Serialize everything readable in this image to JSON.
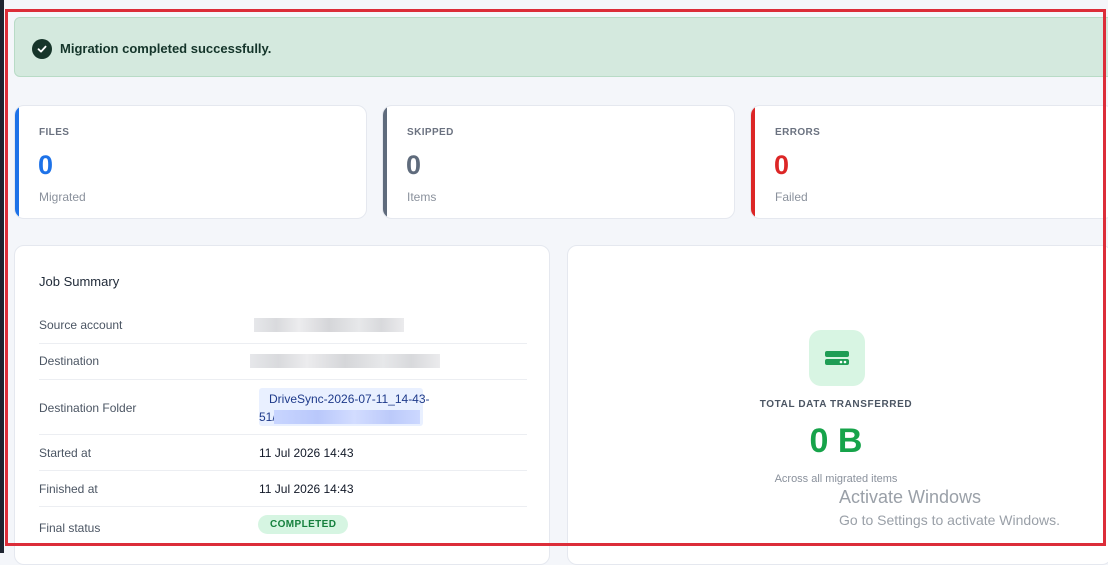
{
  "banner": {
    "message": "Migration completed successfully."
  },
  "stats": {
    "files": {
      "label": "FILES",
      "value": "0",
      "sub": "Migrated",
      "color": "#1d72e8"
    },
    "skipped": {
      "label": "SKIPPED",
      "value": "0",
      "sub": "Items",
      "color": "#5f6b7c"
    },
    "errors": {
      "label": "ERRORS",
      "value": "0",
      "sub": "Failed",
      "color": "#dc2626"
    }
  },
  "summary": {
    "title": "Job Summary",
    "source_label": "Source account",
    "destination_label": "Destination",
    "folder_label": "Destination Folder",
    "folder_value_line1": "DriveSync-2026-07-11_14-43-",
    "folder_value_line2": "51/",
    "started_label": "Started at",
    "started_value": "11 Jul 2026 14:43",
    "finished_label": "Finished at",
    "finished_value": "11 Jul 2026 14:43",
    "status_label": "Final status",
    "status_value": "COMPLETED"
  },
  "transfer": {
    "label": "TOTAL DATA TRANSFERRED",
    "value": "0 B",
    "sub": "Across all migrated items"
  },
  "watermark": {
    "line1": "Activate Windows",
    "line2": "Go to Settings to activate Windows."
  },
  "colors": {
    "success_bg": "#d4e9de",
    "success_green": "#16a34a",
    "annotation_red": "#dc2d39"
  },
  "icons": {
    "banner": "check-circle-icon",
    "transfer": "hard-drive-icon"
  }
}
